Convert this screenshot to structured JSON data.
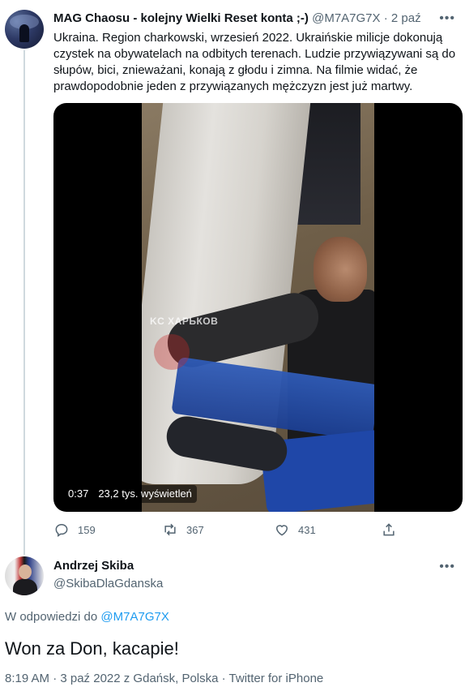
{
  "parent_tweet": {
    "author_name": "MAG Chaosu - kolejny Wielki Reset konta ;-)",
    "author_handle": "@M7A7G7X",
    "separator": " · ",
    "time": "2 paź",
    "text": "Ukraina. Region charkowski, wrzesień 2022. Ukraińskie milicje dokonują czystek na obywatelach na odbitych terenach. Ludzie przywiązywani są do słupów, bici, znieważani, konają z głodu i zimna. Na filmie widać, że prawdopodobnie jeden z przywiązanych mężczyzn jest już martwy.",
    "more_icon": "ellipsis-icon",
    "video": {
      "duration": "0:37",
      "views": "23,2 tys. wyświetleń",
      "watermark": "KC ХАРЬКОВ"
    },
    "actions": {
      "replies": "159",
      "retweets": "367",
      "likes": "431"
    }
  },
  "reply_tweet": {
    "author_name": "Andrzej Skiba",
    "author_handle": "@SkibaDlaGdanska",
    "replying_prefix": "W odpowiedzi do",
    "replying_to": "@M7A7G7X",
    "text": "Won za Don, kacapie!",
    "meta": "8:19 AM · 3 paź 2022 z Gdańsk, Polska · Twitter for iPhone",
    "more_icon": "ellipsis-icon"
  },
  "colors": {
    "text": "#0f1419",
    "secondary": "#536471",
    "link": "#1d9bf0",
    "thread_line": "#cfd9de"
  }
}
